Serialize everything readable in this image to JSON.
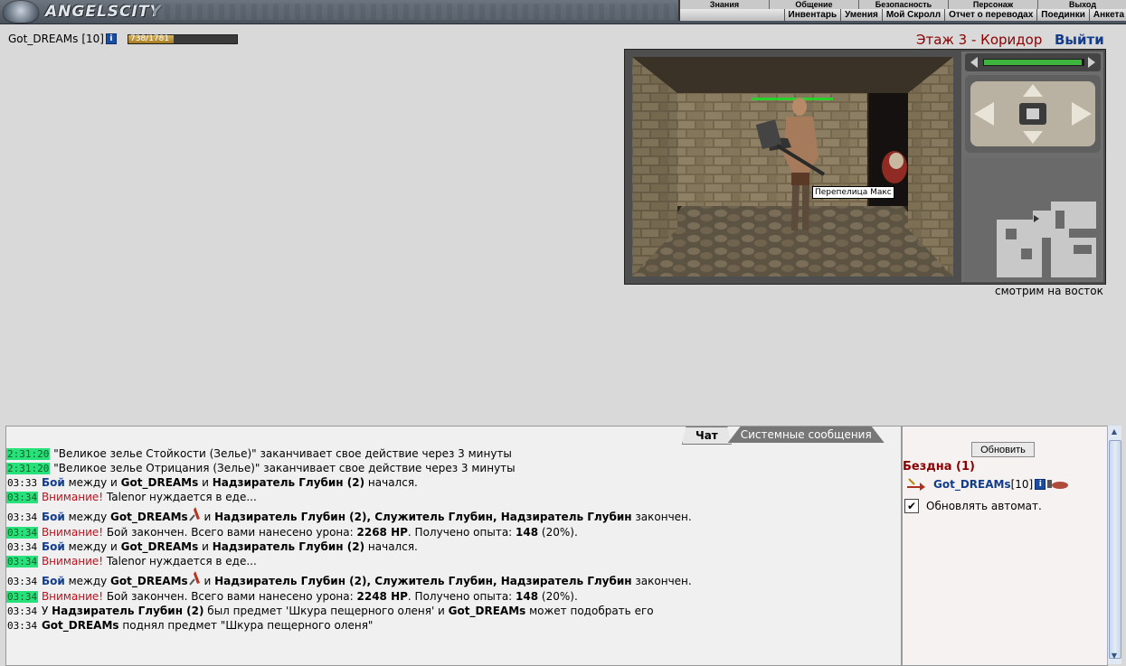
{
  "app": {
    "logo_text": "ANGELSCITY"
  },
  "top_menu": {
    "primary": [
      "Знания",
      "Общение",
      "Безопасность",
      "Персонаж",
      "Выход"
    ],
    "secondary": [
      "Инвентарь",
      "Умения",
      "Мой Скролл",
      "Отчет о переводах",
      "Поединки",
      "Анкета"
    ]
  },
  "player": {
    "name": "Got_DREAMs",
    "level": "[10]",
    "hp_text": "738/1781",
    "hp_fraction": 0.414
  },
  "location": {
    "title": "Этаж 3 - Коридор",
    "exit_label": "Выйти",
    "facing": "смотрим на восток",
    "npc_label": "Перепелица Макс"
  },
  "chat": {
    "tab_chat": "Чат",
    "tab_system": "Системные сообщения",
    "lines": [
      {
        "time": "2:31:20",
        "hl": true,
        "parts": [
          {
            "t": "\"Великое зелье Стойкости (Зелье)\" заканчивает свое действие через 3 минуты"
          }
        ]
      },
      {
        "time": "2:31:20",
        "hl": true,
        "parts": [
          {
            "t": "\"Великое зелье Отрицания (Зелье)\" заканчивает свое действие через 3 минуты"
          }
        ]
      },
      {
        "time": "03:33",
        "hl": false,
        "parts": [
          {
            "t": "Бой",
            "c": "battle"
          },
          {
            "t": " между и "
          },
          {
            "t": "Got_DREAMs",
            "b": true
          },
          {
            "t": " и "
          },
          {
            "t": "Надзиратель Глубин (2)",
            "b": true
          },
          {
            "t": " начался."
          }
        ]
      },
      {
        "time": "03:34",
        "hl": true,
        "parts": [
          {
            "t": "Внимание!",
            "c": "warn"
          },
          {
            "t": " Talenor нуждается в еде..."
          }
        ]
      },
      {
        "time": "03:34",
        "hl": false,
        "tall": true,
        "parts": [
          {
            "t": "Бой",
            "c": "battle"
          },
          {
            "t": " между "
          },
          {
            "t": "Got_DREAMs",
            "b": true
          },
          {
            "icon": "sword"
          },
          {
            "t": " и "
          },
          {
            "t": "Надзиратель Глубин (2), Служитель Глубин, Надзиратель Глубин",
            "b": true
          },
          {
            "t": " закончен."
          }
        ]
      },
      {
        "time": "03:34",
        "hl": true,
        "parts": [
          {
            "t": "Внимание!",
            "c": "warn"
          },
          {
            "t": " Бой закончен. Всего вами нанесено урона: "
          },
          {
            "t": "2268 HP",
            "b": true
          },
          {
            "t": ". Получено опыта: "
          },
          {
            "t": "148",
            "b": true
          },
          {
            "t": " (20%)."
          }
        ]
      },
      {
        "time": "03:34",
        "hl": false,
        "parts": [
          {
            "t": "Бой",
            "c": "battle"
          },
          {
            "t": " между и "
          },
          {
            "t": "Got_DREAMs",
            "b": true
          },
          {
            "t": " и "
          },
          {
            "t": "Надзиратель Глубин (2)",
            "b": true
          },
          {
            "t": " начался."
          }
        ]
      },
      {
        "time": "03:34",
        "hl": true,
        "parts": [
          {
            "t": "Внимание!",
            "c": "warn"
          },
          {
            "t": " Talenor нуждается в еде..."
          }
        ]
      },
      {
        "time": "03:34",
        "hl": false,
        "tall": true,
        "parts": [
          {
            "t": "Бой",
            "c": "battle"
          },
          {
            "t": " между "
          },
          {
            "t": "Got_DREAMs",
            "b": true
          },
          {
            "icon": "sword"
          },
          {
            "t": " и "
          },
          {
            "t": "Надзиратель Глубин (2), Служитель Глубин, Надзиратель Глубин",
            "b": true
          },
          {
            "t": " закончен."
          }
        ]
      },
      {
        "time": "03:34",
        "hl": true,
        "parts": [
          {
            "t": "Внимание!",
            "c": "warn"
          },
          {
            "t": " Бой закончен. Всего вами нанесено урона: "
          },
          {
            "t": "2248 HP",
            "b": true
          },
          {
            "t": ". Получено опыта: "
          },
          {
            "t": "148",
            "b": true
          },
          {
            "t": " (20%)."
          }
        ]
      },
      {
        "time": "03:34",
        "hl": false,
        "parts": [
          {
            "t": "У "
          },
          {
            "t": "Надзиратель Глубин (2)",
            "b": true
          },
          {
            "t": " был предмет 'Шкура пещерного оленя' и "
          },
          {
            "t": "Got_DREAMs",
            "b": true
          },
          {
            "t": " может подобрать его"
          }
        ]
      },
      {
        "time": "03:34",
        "hl": false,
        "parts": [
          {
            "t": "Got_DREAMs",
            "b": true
          },
          {
            "t": " поднял предмет \"Шкура пещерного оленя\""
          }
        ]
      }
    ]
  },
  "side": {
    "refresh_label": "Обновить",
    "room_title": "Бездна (1)",
    "online": [
      {
        "name": "Got_DREAMs",
        "level": "[10]"
      }
    ],
    "auto_refresh_label": "Обновлять автомат.",
    "auto_refresh_checked": true
  },
  "colors": {
    "battle": "#123c8c",
    "warning": "#c0111c",
    "timestamp_highlight": "#27e27b",
    "location": "#8b0000"
  }
}
